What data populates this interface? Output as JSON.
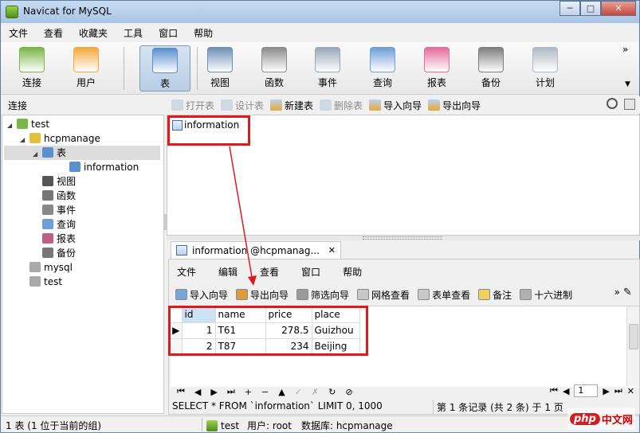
{
  "window": {
    "title": "Navicat for MySQL",
    "min": "─",
    "max": "□",
    "close": "✕"
  },
  "menu": [
    "文件",
    "查看",
    "收藏夹",
    "工具",
    "窗口",
    "帮助"
  ],
  "toolbar": [
    {
      "label": "连接",
      "icon": "plug-icon",
      "color": "#7ab648"
    },
    {
      "label": "用户",
      "icon": "user-icon",
      "color": "#f2a93b"
    },
    {
      "label": "表",
      "icon": "table-icon",
      "color": "#5a8fd0"
    },
    {
      "label": "视图",
      "icon": "view-icon",
      "color": "#6d8fb5"
    },
    {
      "label": "函数",
      "icon": "function-icon",
      "color": "#8c8c8c"
    },
    {
      "label": "事件",
      "icon": "event-icon",
      "color": "#9aa7b8"
    },
    {
      "label": "查询",
      "icon": "query-icon",
      "color": "#6d9fd6"
    },
    {
      "label": "报表",
      "icon": "report-icon",
      "color": "#e46c9a"
    },
    {
      "label": "备份",
      "icon": "backup-icon",
      "color": "#7d7d7d"
    },
    {
      "label": "计划",
      "icon": "schedule-icon",
      "color": "#b0b8c4"
    }
  ],
  "toolbar_more": "»",
  "left_header": "连接",
  "tree": [
    {
      "label": "test",
      "level": 0,
      "exp": "◢",
      "icon": "connection-icon",
      "color": "#7ab648"
    },
    {
      "label": "hcpmanage",
      "level": 1,
      "exp": "◢",
      "icon": "database-icon",
      "color": "#e3c23a"
    },
    {
      "label": "表",
      "level": 2,
      "exp": "◢",
      "icon": "table-icon",
      "color": "#5a8fd0",
      "selected": true
    },
    {
      "label": "information",
      "level": 3,
      "exp": "",
      "icon": "table-icon",
      "color": "#5a8fd0"
    },
    {
      "label": "视图",
      "level": 2,
      "exp": "",
      "icon": "view-icon",
      "color": "#555"
    },
    {
      "label": "函数",
      "level": 2,
      "exp": "",
      "icon": "function-icon",
      "color": "#777"
    },
    {
      "label": "事件",
      "level": 2,
      "exp": "",
      "icon": "event-icon",
      "color": "#888"
    },
    {
      "label": "查询",
      "level": 2,
      "exp": "",
      "icon": "query-icon",
      "color": "#6d9fd6"
    },
    {
      "label": "报表",
      "level": 2,
      "exp": "",
      "icon": "report-icon",
      "color": "#c06080"
    },
    {
      "label": "备份",
      "level": 2,
      "exp": "",
      "icon": "backup-icon",
      "color": "#777"
    },
    {
      "label": "mysql",
      "level": 1,
      "exp": "",
      "icon": "database-icon",
      "color": "#aaa"
    },
    {
      "label": "test",
      "level": 1,
      "exp": "",
      "icon": "database-icon",
      "color": "#aaa"
    }
  ],
  "objtoolbar": [
    {
      "label": "打开表",
      "disabled": true,
      "icon": "open-table-icon"
    },
    {
      "label": "设计表",
      "disabled": true,
      "icon": "design-table-icon"
    },
    {
      "label": "新建表",
      "disabled": false,
      "icon": "new-table-icon"
    },
    {
      "label": "删除表",
      "disabled": true,
      "icon": "delete-table-icon"
    },
    {
      "label": "导入向导",
      "disabled": false,
      "icon": "import-wizard-icon"
    },
    {
      "label": "导出向导",
      "disabled": false,
      "icon": "export-wizard-icon"
    }
  ],
  "objects": [
    "information"
  ],
  "tab": {
    "title": "information @hcpmanag...",
    "close": "✕"
  },
  "submenu": [
    "文件",
    "编辑",
    "查看",
    "窗口",
    "帮助"
  ],
  "subtoolbar": [
    {
      "label": "导入向导",
      "icon": "import-wizard-icon"
    },
    {
      "label": "导出向导",
      "icon": "export-wizard-icon"
    },
    {
      "label": "筛选向导",
      "icon": "filter-wizard-icon"
    },
    {
      "label": "网格查看",
      "icon": "grid-view-icon"
    },
    {
      "label": "表单查看",
      "icon": "form-view-icon"
    },
    {
      "label": "备注",
      "icon": "memo-icon"
    },
    {
      "label": "十六进制",
      "icon": "hex-icon"
    }
  ],
  "grid": {
    "columns": [
      "id",
      "name",
      "price",
      "place"
    ],
    "rows": [
      [
        "1",
        "T61",
        "278.5",
        "Guizhou"
      ],
      [
        "2",
        "T87",
        "234",
        "Beijing"
      ]
    ]
  },
  "navbar": {
    "buttons": [
      "⏮",
      "◀",
      "▶",
      "⏭",
      "+",
      "−",
      "▲",
      "✓",
      "✗",
      "↻",
      "⊘"
    ],
    "page": "1",
    "page_prev": "◀",
    "page_next": "▶",
    "page_first": "⏮",
    "page_last": "⏭"
  },
  "sql": "SELECT * FROM `information` LIMIT 0, 1000",
  "record_status": "第 1 条记录 (共 2 条) 于 1 页",
  "status": {
    "left": "1 表 (1 位于当前的组)",
    "connection": "test",
    "user": "用户: root",
    "database": "数据库: hcpmanage"
  },
  "watermark": {
    "php": "php",
    "site": "中文网"
  },
  "colors": {
    "highlight": "#e01a1a",
    "arrow": "#e01a1a"
  }
}
